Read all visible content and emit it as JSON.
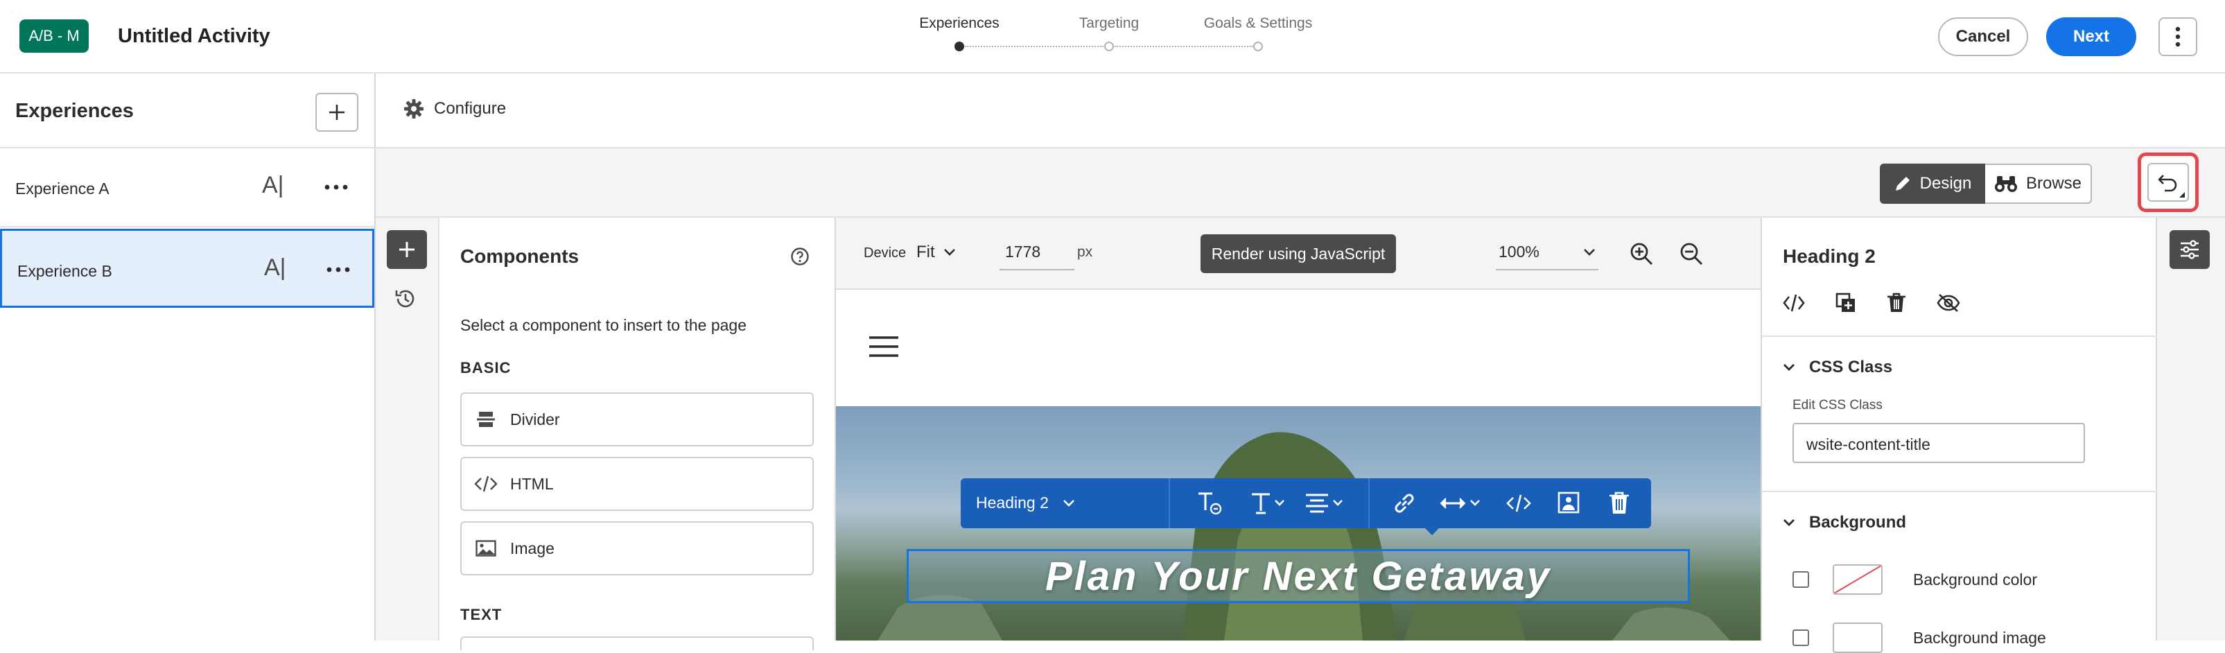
{
  "header": {
    "badge": "A/B - M",
    "title": "Untitled Activity",
    "steps": [
      {
        "label": "Experiences",
        "active": true
      },
      {
        "label": "Targeting",
        "active": false
      },
      {
        "label": "Goals & Settings",
        "active": false
      }
    ],
    "cancel_label": "Cancel",
    "next_label": "Next"
  },
  "experiences": {
    "title": "Experiences",
    "items": [
      {
        "name": "Experience A",
        "font_glyph": "A|",
        "selected": false
      },
      {
        "name": "Experience B",
        "font_glyph": "A|",
        "selected": true
      }
    ]
  },
  "configure": {
    "label": "Configure"
  },
  "modes": {
    "design_label": "Design",
    "browse_label": "Browse"
  },
  "components": {
    "title": "Components",
    "description": "Select a component to insert to the page",
    "sections": [
      {
        "title": "BASIC",
        "items": [
          {
            "label": "Divider",
            "icon": "divider-icon"
          },
          {
            "label": "HTML",
            "icon": "code-icon"
          },
          {
            "label": "Image",
            "icon": "image-icon"
          }
        ]
      },
      {
        "title": "TEXT",
        "items": []
      }
    ]
  },
  "canvas_toolbar": {
    "device_label": "Device",
    "device_value": "Fit",
    "width_value": "1778",
    "unit": "px",
    "render_label": "Render using JavaScript",
    "zoom_value": "100%"
  },
  "editor": {
    "element_type": "Heading 2",
    "heading_text": "Plan Your Next Getaway"
  },
  "properties": {
    "title": "Heading 2",
    "css_section": "CSS Class",
    "css_field_label": "Edit CSS Class",
    "css_value": "wsite-content-title",
    "background_section": "Background",
    "background_color_label": "Background color",
    "background_image_label": "Background image"
  },
  "colors": {
    "accent": "#1473e6",
    "badge": "#017659",
    "highlight": "#e34850",
    "rte_toolbar": "#1a5fb7"
  }
}
